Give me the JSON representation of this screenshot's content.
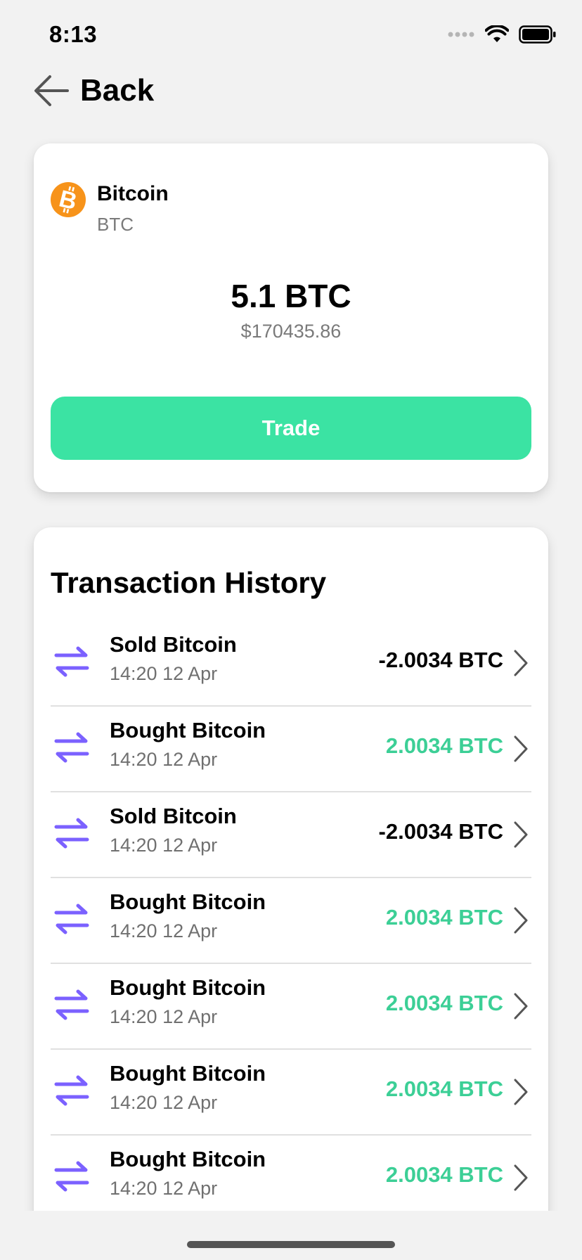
{
  "status_bar": {
    "time": "8:13",
    "signal_icon": "signal-dots-icon",
    "wifi_icon": "wifi-icon",
    "battery_icon": "battery-icon"
  },
  "nav": {
    "back_icon": "arrow-left-icon",
    "back_label": "Back"
  },
  "asset": {
    "icon": "bitcoin-icon",
    "name": "Bitcoin",
    "ticker": "BTC",
    "balance": "5.1 BTC",
    "balance_usd": "$170435.86",
    "trade_label": "Trade"
  },
  "history": {
    "title": "Transaction History",
    "item_icon": "exchange-arrows-icon",
    "chevron_icon": "chevron-right-icon",
    "transactions": [
      {
        "title": "Sold Bitcoin",
        "time": "14:20 12 Apr",
        "amount": "-2.0034 BTC"
      },
      {
        "title": "Bought Bitcoin",
        "time": "14:20 12 Apr",
        "amount": "2.0034 BTC"
      },
      {
        "title": "Sold Bitcoin",
        "time": "14:20 12 Apr",
        "amount": "-2.0034 BTC"
      },
      {
        "title": "Bought Bitcoin",
        "time": "14:20 12 Apr",
        "amount": "2.0034 BTC"
      },
      {
        "title": "Bought Bitcoin",
        "time": "14:20 12 Apr",
        "amount": "2.0034 BTC"
      },
      {
        "title": "Bought Bitcoin",
        "time": "14:20 12 Apr",
        "amount": "2.0034 BTC"
      },
      {
        "title": "Bought Bitcoin",
        "time": "14:20 12 Apr",
        "amount": "2.0034 BTC"
      }
    ]
  },
  "colors": {
    "background": "#f2f2f2",
    "accent_green": "#3be3a3",
    "positive_amount": "#3ccf96",
    "exchange_icon": "#7b61ff",
    "bitcoin_orange": "#f7931a"
  }
}
